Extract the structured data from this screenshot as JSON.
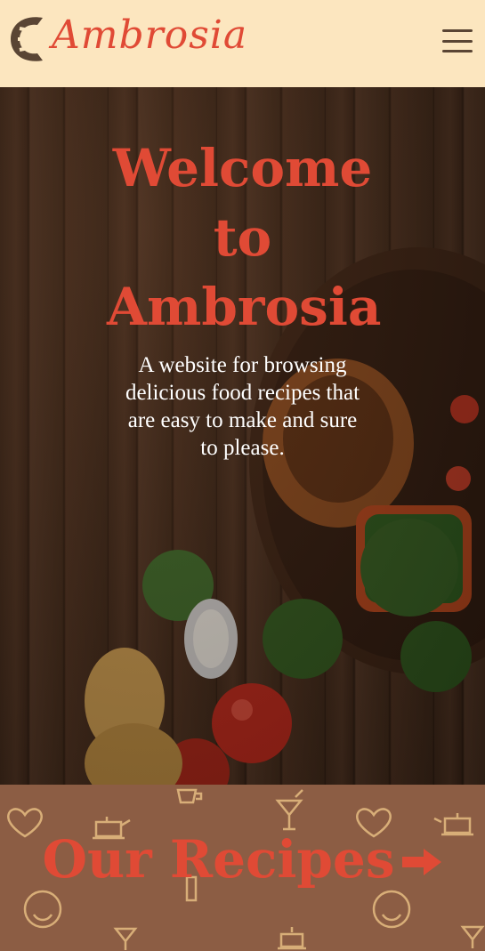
{
  "header": {
    "brand": "Ambrosia",
    "logo_icon": "croissant-icon",
    "menu_icon": "hamburger-menu-icon"
  },
  "hero": {
    "title": "Welcome to Ambrosia",
    "description": "A website for browsing delicious food recipes that are easy to make and sure to please."
  },
  "recipes": {
    "label": "Our Recipes",
    "arrow_icon": "arrow-right-icon"
  },
  "colors": {
    "header_bg": "#fce6bf",
    "accent": "#e04a35",
    "recipes_bg": "#8c5d44",
    "pattern": "#f2c98a"
  }
}
